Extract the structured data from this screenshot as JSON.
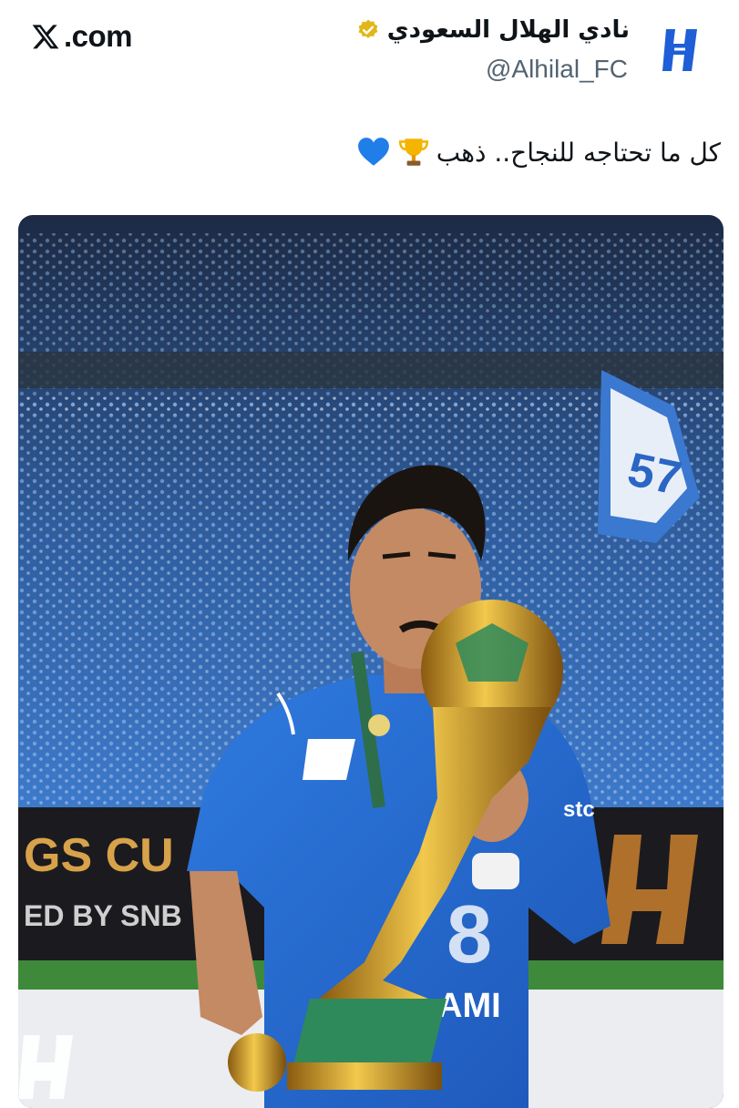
{
  "site": {
    "label": ".com"
  },
  "account": {
    "name": "نادي الهلال السعودي",
    "handle": "@Alhilal_FC",
    "verified_color": "#e2b719"
  },
  "tweet": {
    "text": "كل ما تحتاجه للنجاح.. ذهب",
    "emojis": [
      "trophy-emoji",
      "blue-heart-emoji"
    ]
  },
  "photo": {
    "banner_left": "GS CU",
    "banner_sponsor": "ED BY  SNB",
    "flag_text": "57",
    "jersey_name": "AMI",
    "jersey_number": "8",
    "sleeve_text": "stc",
    "hilal_blue": "#2a6fd6"
  }
}
